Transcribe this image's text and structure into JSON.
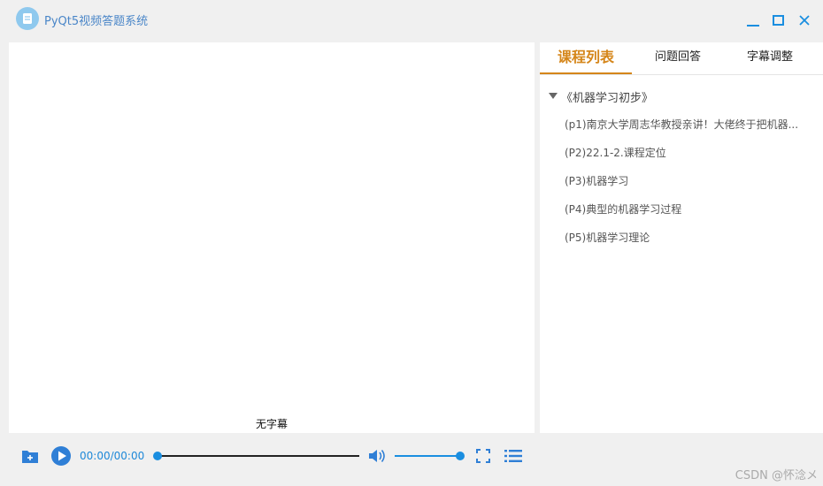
{
  "window": {
    "title": "PyQt5视频答题系统"
  },
  "video": {
    "subtitle": "无字幕"
  },
  "side_panel": {
    "tabs": [
      {
        "label": "课程列表",
        "active": true
      },
      {
        "label": "问题回答",
        "active": false
      },
      {
        "label": "字幕调整",
        "active": false
      }
    ],
    "course": {
      "title": "《机器学习初步》",
      "episodes": [
        "(p1)南京大学周志华教授亲讲！大佬终于把机器...",
        "(P2)22.1-2.课程定位",
        "(P3)机器学习",
        "(P4)典型的机器学习过程",
        "(P5)机器学习理论"
      ]
    }
  },
  "player": {
    "time": "00:00/00:00",
    "progress_fraction": 0,
    "volume_fraction": 1.0,
    "accent_color": "#1a8ee0"
  },
  "watermark": "CSDN @怀淰メ",
  "icons": [
    "app-logo-icon",
    "minimize-icon",
    "maximize-icon",
    "close-icon",
    "folder-add-icon",
    "play-icon",
    "volume-icon",
    "fullscreen-icon",
    "playlist-icon",
    "tree-expand-icon"
  ]
}
